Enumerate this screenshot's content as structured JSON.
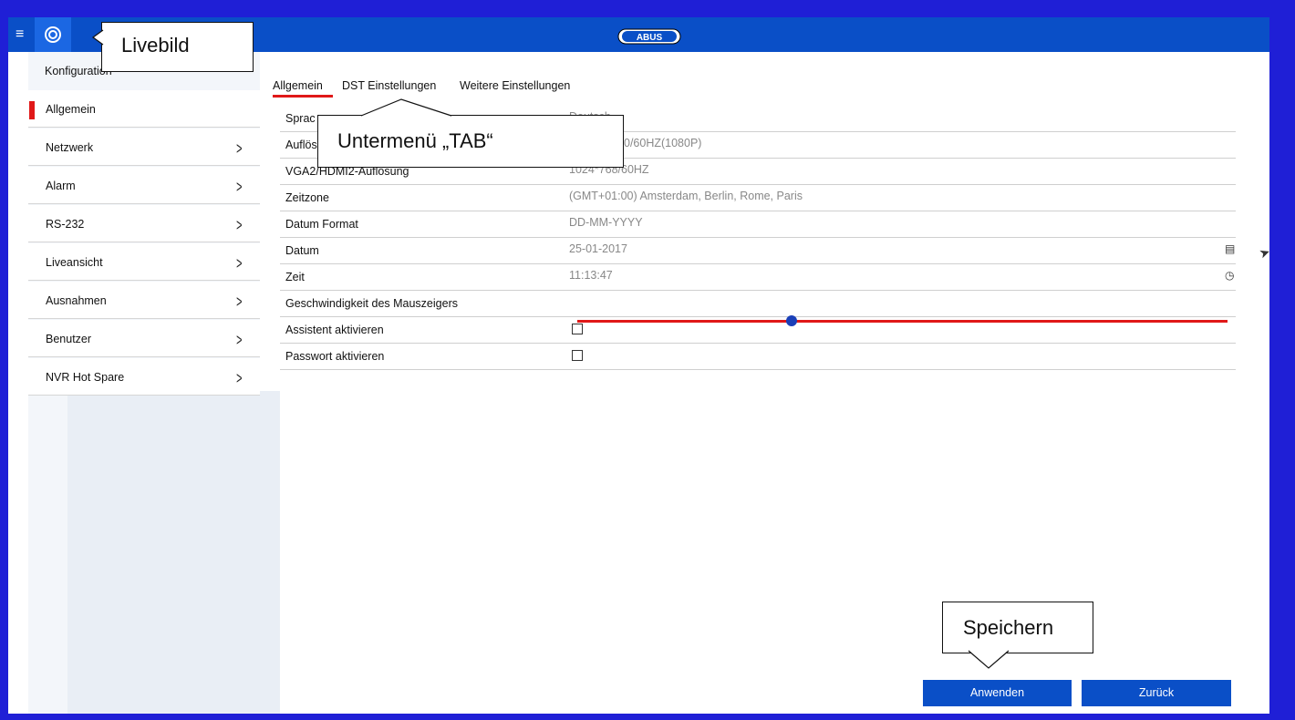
{
  "topbar": {
    "logo": "ABUS"
  },
  "callouts": {
    "live": "Livebild",
    "tab": "Untermenü „TAB“",
    "save": "Speichern"
  },
  "sidebar": {
    "title": "Konfiguration",
    "items": [
      {
        "label": "Allgemein",
        "active": true
      },
      {
        "label": "Netzwerk"
      },
      {
        "label": "Alarm"
      },
      {
        "label": "RS-232"
      },
      {
        "label": "Liveansicht"
      },
      {
        "label": "Ausnahmen"
      },
      {
        "label": "Benutzer"
      },
      {
        "label": "NVR Hot Spare"
      }
    ]
  },
  "tabs": [
    "Allgemein",
    "DST Einstellungen",
    "Weitere Einstellungen"
  ],
  "settings": [
    {
      "label": "Sprac",
      "value": "Deutsch"
    },
    {
      "label": "Auflös",
      "value": "0/60HZ(1080P)"
    },
    {
      "label": "VGA2/HDMI2-Auflösung",
      "value": "1024*768/60HZ"
    },
    {
      "label": "Zeitzone",
      "value": "(GMT+01:00) Amsterdam, Berlin, Rome, Paris"
    },
    {
      "label": "Datum Format",
      "value": "DD-MM-YYYY"
    },
    {
      "label": "Datum",
      "value": "25-01-2017"
    },
    {
      "label": "Zeit",
      "value": "11:13:47"
    },
    {
      "label": "Geschwindigkeit des Mauszeigers",
      "level": 0.33
    },
    {
      "label": "Assistent aktivieren",
      "checked": false
    },
    {
      "label": "Passwort aktivieren",
      "checked": false
    }
  ],
  "buttons": {
    "apply": "Anwenden",
    "back": "Zurück"
  }
}
